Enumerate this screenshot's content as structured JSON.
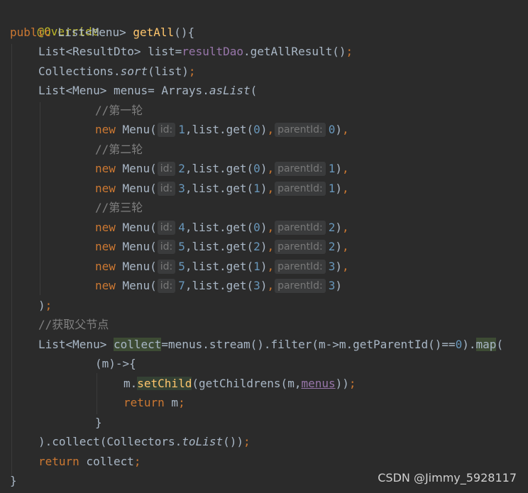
{
  "code": {
    "l1_annotation": "@Override",
    "l2_public": "public",
    "l2_type": " List<Menu> ",
    "l2_method": "getAll",
    "l2_end": "(){",
    "l3_a": "List<ResultDto> list=",
    "l3_field": "resultDao",
    "l3_b": ".getAllResult()",
    "l3_semi": ";",
    "l4_a": "Collections.",
    "l4_sort": "sort",
    "l4_b": "(list)",
    "l4_semi": ";",
    "l5_a": "List<Menu> menus= Arrays.",
    "l5_aslist": "asList",
    "l5_b": "(",
    "comment_round1": "//第一轮",
    "comment_round2": "//第二轮",
    "comment_round3": "//第三轮",
    "comment_parent": "//获取父节点",
    "new_kw": "new",
    "menu_ctor": " Menu(",
    "hint_id": "id:",
    "hint_parent": "parentId:",
    "list_get": ",list.get(",
    "menus": [
      {
        "id": "1",
        "get": "0",
        "parent": "0",
        "end": "),"
      },
      {
        "id": "2",
        "get": "0",
        "parent": "1",
        "end": "),"
      },
      {
        "id": "3",
        "get": "1",
        "parent": "1",
        "end": "),"
      },
      {
        "id": "4",
        "get": "0",
        "parent": "2",
        "end": "),"
      },
      {
        "id": "5",
        "get": "2",
        "parent": "2",
        "end": "),"
      },
      {
        "id": "5",
        "get": "1",
        "parent": "3",
        "end": "),"
      },
      {
        "id": "7",
        "get": "3",
        "parent": "3",
        "end": ")"
      }
    ],
    "close_paren": ")",
    "semicolon": ";",
    "stream_a": "List<Menu> ",
    "stream_collect": "collect",
    "stream_b": "=menus.stream().filter(m->m.getParentId()==",
    "stream_zero": "0",
    "stream_c": ").",
    "stream_map": "map",
    "stream_d": "(",
    "lambda_head": "(m)->{",
    "setchild_a": "m.",
    "setchild_fn": "setChild",
    "setchild_b": "(getChildrens(m,",
    "setchild_menus": "menus",
    "setchild_c": ")",
    "return_kw": "return",
    "return_m": " m",
    "close_brace": "}",
    "collect_end_a": ").collect(Collectors.",
    "collect_tolist": "toList",
    "collect_end_b": "())",
    "return_collect": " collect",
    "final_brace": "}"
  },
  "watermark": "CSDN @Jimmy_5928117"
}
